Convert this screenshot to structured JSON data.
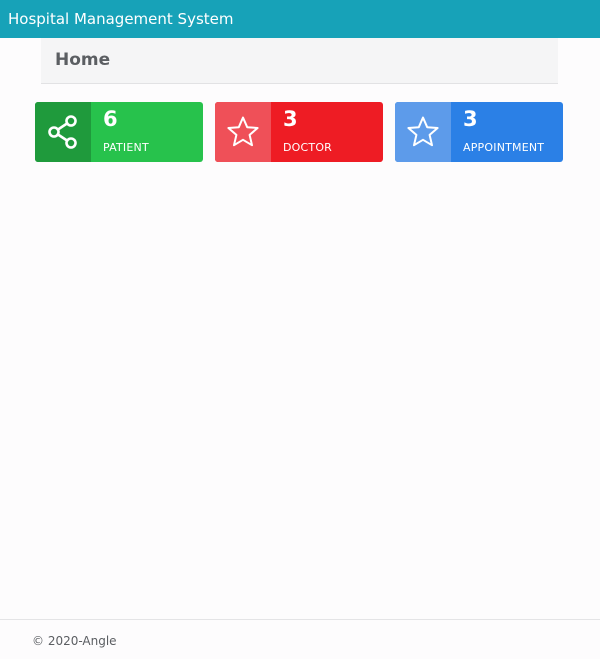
{
  "app": {
    "title": "Hospital Management System"
  },
  "breadcrumb": {
    "title": "Home"
  },
  "cards": {
    "patient": {
      "count": "6",
      "label": "PATIENT",
      "icon": "share-icon",
      "color": "#27c24c",
      "icon_bg": "#1f9a3c"
    },
    "doctor": {
      "count": "3",
      "label": "DOCTOR",
      "icon": "star-icon",
      "color": "#ee1c24",
      "icon_bg": "#ef5058"
    },
    "appointment": {
      "count": "3",
      "label": "APPOINTMENT",
      "icon": "star-icon",
      "color": "#2b80e6",
      "icon_bg": "#5d9bea"
    }
  },
  "footer": {
    "text": "© 2020-Angle"
  },
  "colors": {
    "topbar": "#17a2b8"
  }
}
